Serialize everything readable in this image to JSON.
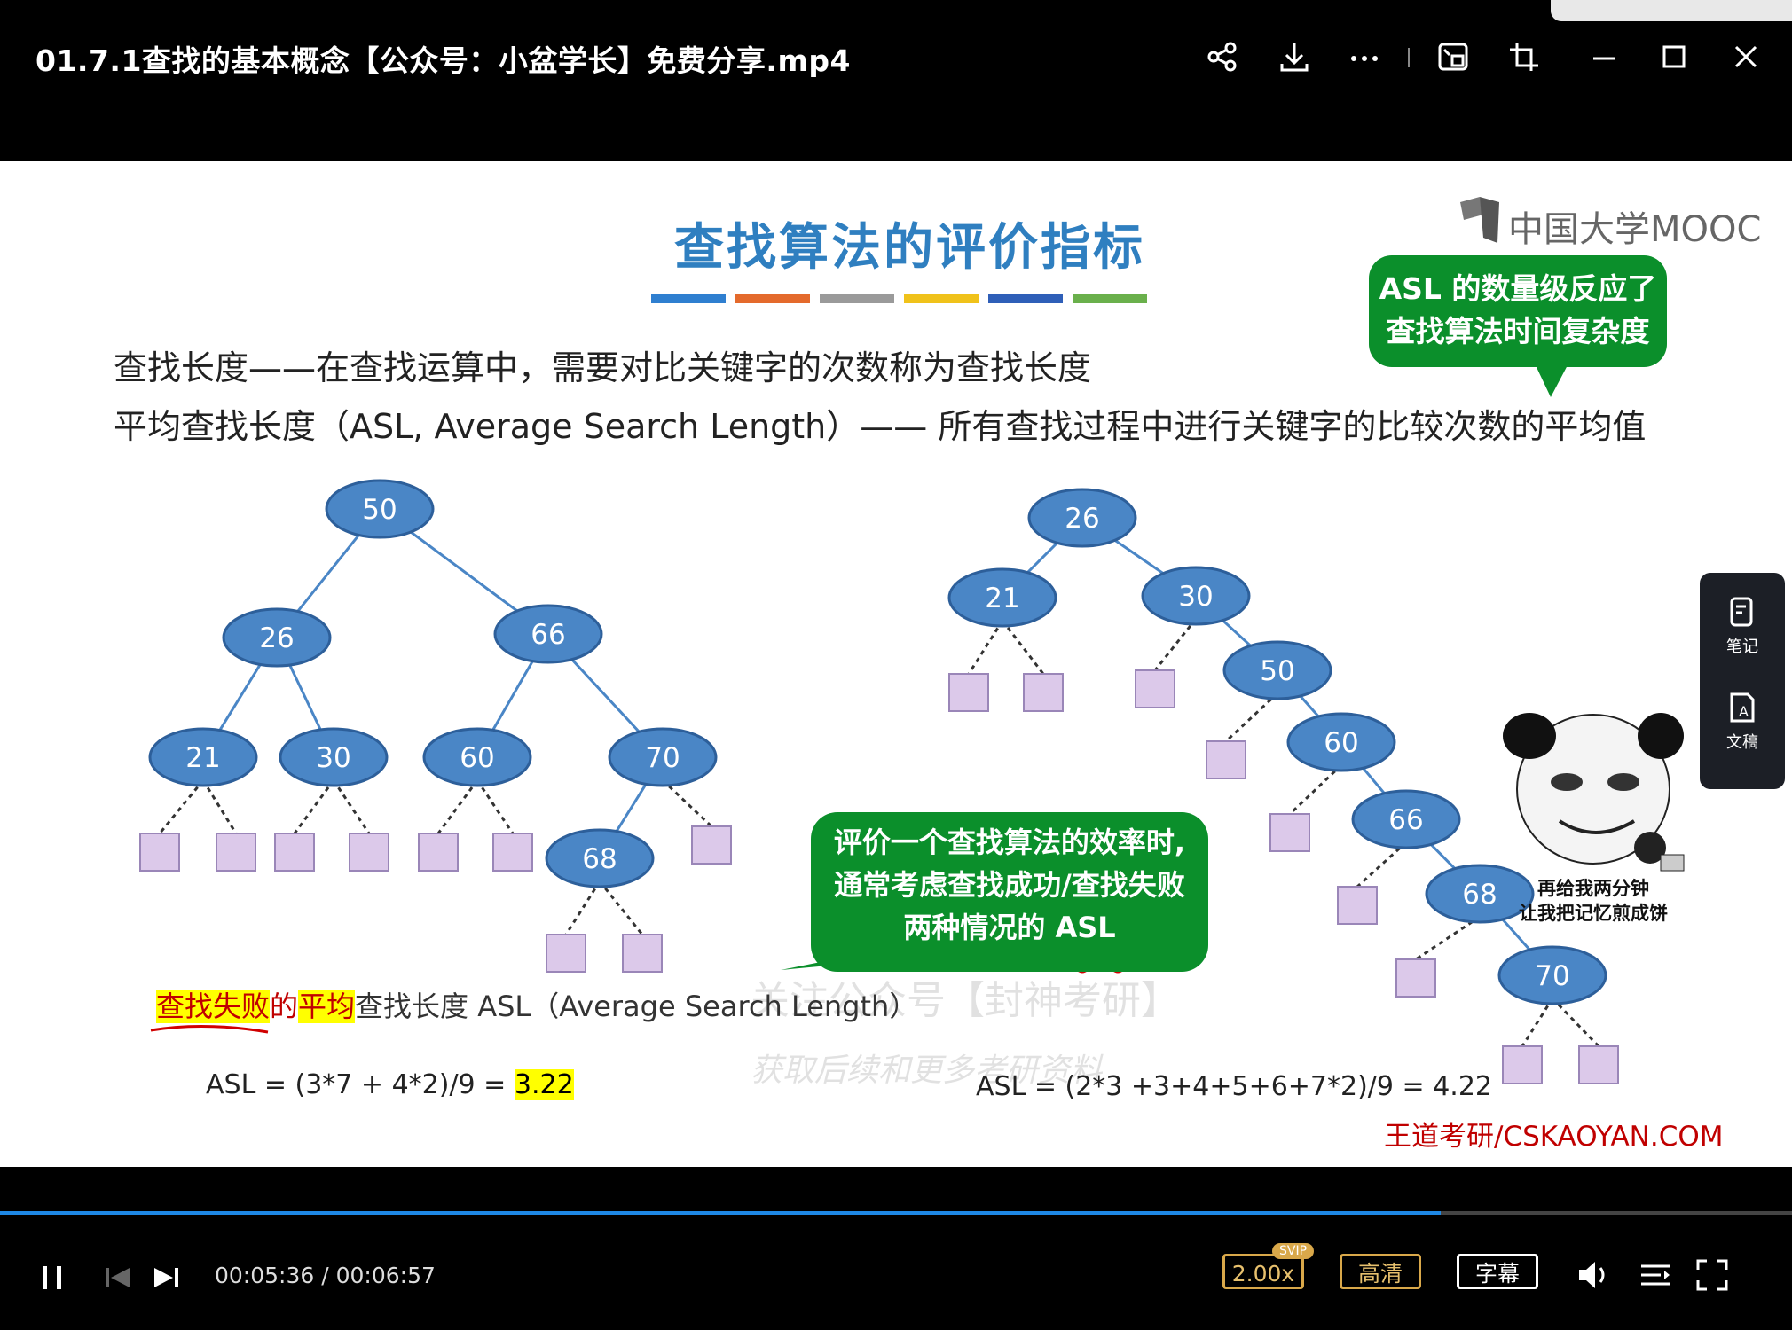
{
  "window": {
    "title": "01.7.1查找的基本概念【公众号：小盆学长】免费分享.mp4",
    "icons": [
      "share-icon",
      "download-icon",
      "more-icon",
      "pip-icon",
      "crop-icon",
      "minimize-icon",
      "maximize-icon",
      "close-icon"
    ]
  },
  "slide": {
    "heading": "查找算法的评价指标",
    "bar_colors": [
      "#2f7fd0",
      "#e46a2c",
      "#9a9a9a",
      "#f0c21a",
      "#2f5fb8",
      "#6ab04c"
    ],
    "line1": "查找长度——在查找运算中，需要对比关键字的次数称为查找长度",
    "line2": "平均查找长度（ASL, Average Search Length）—— 所有查找过程中进行关键字的比较次数的平均值",
    "mooc_logo": "中国大学MOOC",
    "bubble_top": [
      "ASL 的数量级反应了",
      "查找算法时间复杂度"
    ],
    "bubble_mid": [
      "评价一个查找算法的效率时,",
      "通常考虑查找成功/查找失败",
      "两种情况的 ASL"
    ],
    "fail_prefix": "查找失败",
    "fail_mid1": "的",
    "fail_avg": "平均",
    "fail_rest": "查找长度 ASL（Average Search Length）",
    "asl_left_text": "ASL = (3*7 + 4*2)/9 = ",
    "asl_left_value": "3.22",
    "asl_right": "ASL = (2*3 +3+4+5+6+7*2)/9 = 4.22",
    "brand": "王道考研/CSKAOYAN.COM",
    "watermark1": "关注公众号【封神考研】",
    "watermark2": "获取后续和更多考研资料",
    "meme_caption": [
      "再给我两分钟",
      "让我把记忆煎成饼"
    ],
    "tree_left": {
      "nodes": [
        {
          "key": "50"
        },
        {
          "key": "26"
        },
        {
          "key": "66"
        },
        {
          "key": "21"
        },
        {
          "key": "30"
        },
        {
          "key": "60"
        },
        {
          "key": "70"
        },
        {
          "key": "68"
        }
      ]
    },
    "tree_right": {
      "nodes": [
        {
          "key": "26"
        },
        {
          "key": "21"
        },
        {
          "key": "30"
        },
        {
          "key": "50"
        },
        {
          "key": "60"
        },
        {
          "key": "66"
        },
        {
          "key": "68"
        },
        {
          "key": "70"
        }
      ]
    },
    "colors": {
      "node_fill": "#4a86c6",
      "node_stroke": "#2d5f9a",
      "leaf_fill": "#dcc9ea",
      "leaf_stroke": "#9a86b8",
      "bubble_green": "#0b8f2b",
      "brand_red": "#c00000"
    }
  },
  "side_panel": {
    "items": [
      {
        "label": "笔记",
        "icon": "note-icon"
      },
      {
        "label": "文稿",
        "icon": "transcript-icon"
      }
    ]
  },
  "player": {
    "progress_fraction": 0.804,
    "time_current": "00:05:36",
    "time_separator": " / ",
    "time_total": "00:06:57",
    "speed": "2.00x",
    "svip": "SVIP",
    "quality": "高清",
    "subtitle": "字幕"
  }
}
